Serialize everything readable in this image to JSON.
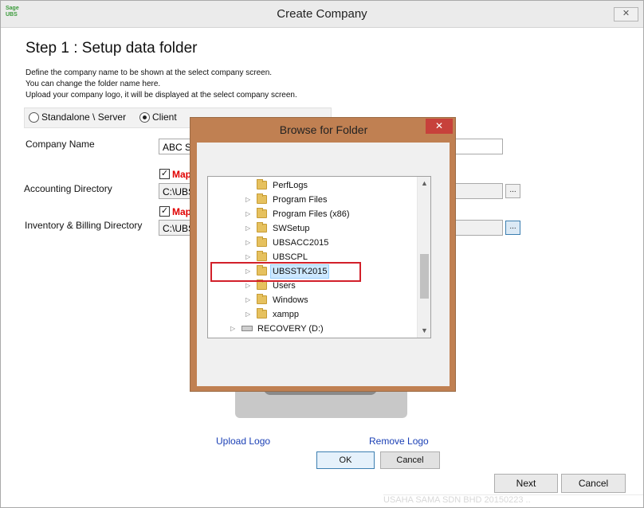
{
  "window": {
    "title": "Create Company",
    "logo_text_top": "Sage",
    "logo_text_bottom": "UBS",
    "close_glyph": "✕"
  },
  "step_title": "Step 1 : Setup data folder",
  "description": [
    "Define the company name to be shown at the select company screen.",
    "You can change the folder name here.",
    "Upload your company logo, it will be displayed at the select company screen."
  ],
  "mode": {
    "options": [
      "Standalone \\ Server",
      "Client"
    ],
    "selected": "Client"
  },
  "company_name": {
    "label": "Company Name",
    "value": "ABC S"
  },
  "accounting_directory": {
    "label": "Accounting Directory",
    "map_label": "Map",
    "map_checked": true,
    "value": "C:\\UBS",
    "browse_label": "..."
  },
  "inventory_directory": {
    "label": "Inventory & Billing Directory",
    "map_label": "Map",
    "map_checked": true,
    "value": "C:\\UBS",
    "browse_label": "..."
  },
  "logo_actions": {
    "upload": "Upload Logo",
    "remove": "Remove Logo"
  },
  "footer": {
    "next": "Next",
    "cancel": "Cancel"
  },
  "watermark": "USAHA SAMA SDN BHD 20150223 ..",
  "browse_dialog": {
    "title": "Browse for Folder",
    "close_glyph": "✕",
    "tree": [
      {
        "label": "PerfLogs",
        "type": "folder",
        "expandable": false,
        "selected": false
      },
      {
        "label": "Program Files",
        "type": "folder",
        "expandable": true,
        "selected": false
      },
      {
        "label": "Program Files (x86)",
        "type": "folder",
        "expandable": true,
        "selected": false
      },
      {
        "label": "SWSetup",
        "type": "folder",
        "expandable": true,
        "selected": false
      },
      {
        "label": "UBSACC2015",
        "type": "folder",
        "expandable": true,
        "selected": false
      },
      {
        "label": "UBSCPL",
        "type": "folder",
        "expandable": true,
        "selected": false
      },
      {
        "label": "UBSSTK2015",
        "type": "folder",
        "expandable": true,
        "selected": true
      },
      {
        "label": "Users",
        "type": "folder",
        "expandable": true,
        "selected": false
      },
      {
        "label": "Windows",
        "type": "folder",
        "expandable": true,
        "selected": false
      },
      {
        "label": "xampp",
        "type": "folder",
        "expandable": true,
        "selected": false
      },
      {
        "label": "RECOVERY (D:)",
        "type": "drive",
        "expandable": true,
        "selected": false
      }
    ],
    "ok": "OK",
    "cancel": "Cancel",
    "highlight_color": "#d2202a"
  }
}
